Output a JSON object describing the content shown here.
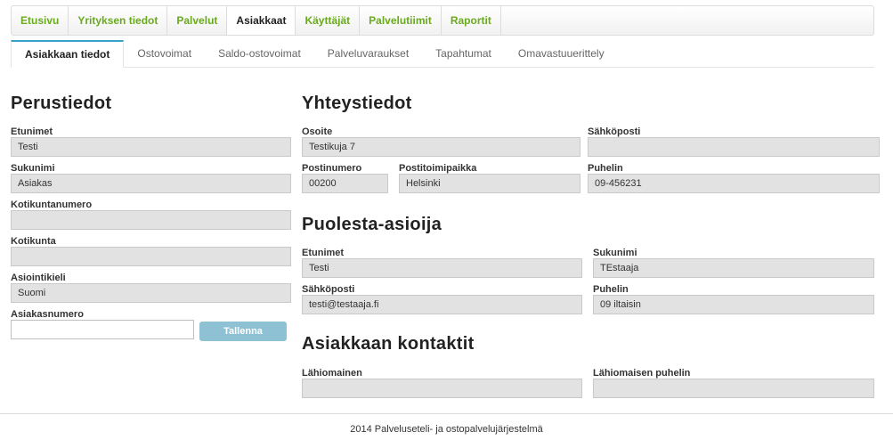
{
  "topnav": {
    "items": [
      {
        "label": "Etusivu",
        "active": false
      },
      {
        "label": "Yrityksen tiedot",
        "active": false
      },
      {
        "label": "Palvelut",
        "active": false
      },
      {
        "label": "Asiakkaat",
        "active": true
      },
      {
        "label": "Käyttäjät",
        "active": false
      },
      {
        "label": "Palvelutiimit",
        "active": false
      },
      {
        "label": "Raportit",
        "active": false
      }
    ]
  },
  "subtabs": {
    "items": [
      {
        "label": "Asiakkaan tiedot",
        "active": true
      },
      {
        "label": "Ostovoimat",
        "active": false
      },
      {
        "label": "Saldo-ostovoimat",
        "active": false
      },
      {
        "label": "Palveluvaraukset",
        "active": false
      },
      {
        "label": "Tapahtumat",
        "active": false
      },
      {
        "label": "Omavastuuerittely",
        "active": false
      }
    ]
  },
  "perustiedot": {
    "title": "Perustiedot",
    "etunimet": {
      "label": "Etunimet",
      "value": "Testi"
    },
    "sukunimi": {
      "label": "Sukunimi",
      "value": "Asiakas"
    },
    "kotikuntanumero": {
      "label": "Kotikuntanumero",
      "value": ""
    },
    "kotikunta": {
      "label": "Kotikunta",
      "value": ""
    },
    "asiointikieli": {
      "label": "Asiointikieli",
      "value": "Suomi"
    },
    "asiakasnumero": {
      "label": "Asiakasnumero",
      "value": ""
    },
    "save_label": "Tallenna"
  },
  "yhteystiedot": {
    "title": "Yhteystiedot",
    "osoite": {
      "label": "Osoite",
      "value": "Testikuja 7"
    },
    "sahkoposti": {
      "label": "Sähköposti",
      "value": ""
    },
    "postinumero": {
      "label": "Postinumero",
      "value": "00200"
    },
    "postitoimipaikka": {
      "label": "Postitoimipaikka",
      "value": "Helsinki"
    },
    "puhelin": {
      "label": "Puhelin",
      "value": "09-456231"
    }
  },
  "puolesta": {
    "title": "Puolesta-asioija",
    "etunimet": {
      "label": "Etunimet",
      "value": "Testi"
    },
    "sukunimi": {
      "label": "Sukunimi",
      "value": "TEstaaja"
    },
    "sahkoposti": {
      "label": "Sähköposti",
      "value": "testi@testaaja.fi"
    },
    "puhelin": {
      "label": "Puhelin",
      "value": "09 iltaisin"
    }
  },
  "kontaktit": {
    "title": "Asiakkaan kontaktit",
    "lahiomainen": {
      "label": "Lähiomainen",
      "value": ""
    },
    "lahiomaisen_puhelin": {
      "label": "Lähiomaisen puhelin",
      "value": ""
    }
  },
  "footer": {
    "text": "2014 Palveluseteli- ja ostopalvelujärjestelmä"
  }
}
